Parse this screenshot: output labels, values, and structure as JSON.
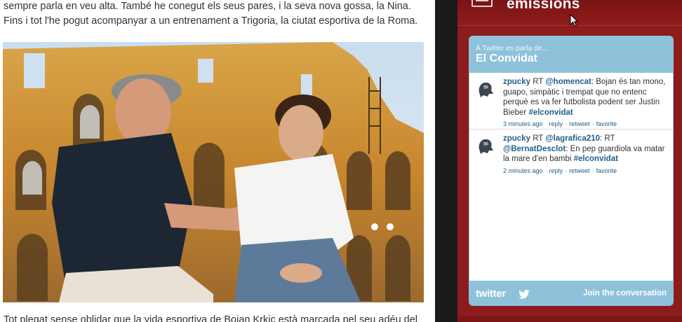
{
  "article": {
    "paragraph_top": "sempre parla en veu alta. També he conegut els seus pares, i la seva nova gossa, la Nina. Fins i tot l'he pogut acompanyar a un entrenament a Trigoria, la ciutat esportiva de la Roma.",
    "paragraph_bottom": "Tot plegat sense oblidar que la vida esportiva de Bojan Krkic està marcada pel seu adéu del"
  },
  "sidebar": {
    "title": "emissions",
    "icon": "tv-icon"
  },
  "widget": {
    "subtitle": "A Twitter es parla de...",
    "title": "El Convidat",
    "tweets": [
      {
        "user": "zpucky",
        "rt": "RT",
        "mention": "@homencat",
        "text": ": Bojan és tan mono, guapo, simpàtic i trempat que no entenc perquè es va fer futbolista podent ser Justin Bieber ",
        "hashtag": "#elconvidat",
        "time": "3 minutes ago",
        "reply": "reply",
        "retweet": "retweet",
        "favorite": "favorite"
      },
      {
        "user": "zpucky",
        "rt": "RT",
        "mention": "@lagrafica210",
        "text_a": ": RT ",
        "mention2": "@BernatDesclot",
        "text_b": ": En pep guardiola va matar la mare d'en bambi ",
        "hashtag": "#elconvidat",
        "time": "2 minutes ago",
        "reply": "reply",
        "retweet": "retweet",
        "favorite": "favorite"
      }
    ],
    "logo": "twitter",
    "join": "Join the conversation"
  },
  "colors": {
    "sidebar": "#8c1b1b",
    "widget": "#8ec1da",
    "link": "#1f5f8a"
  }
}
